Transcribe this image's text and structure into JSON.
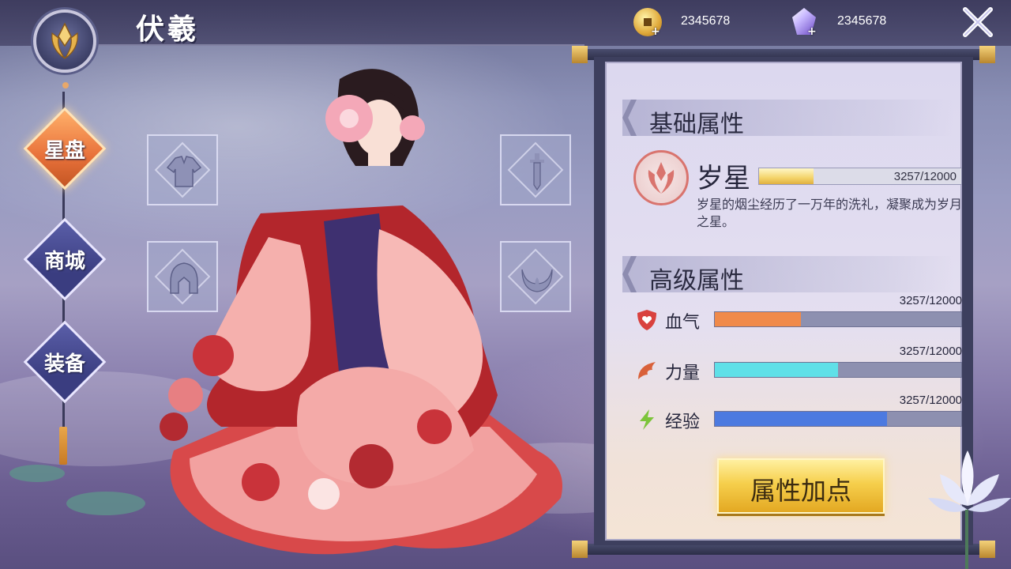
{
  "header": {
    "title": "伏羲",
    "currencies": [
      {
        "icon": "gold-coin-icon",
        "value": "2345678"
      },
      {
        "icon": "purple-crystal-icon",
        "value": "2345678"
      }
    ],
    "close_icon": "close-icon"
  },
  "nav": {
    "items": [
      {
        "label": "星盘",
        "active": true
      },
      {
        "label": "商城",
        "active": false
      },
      {
        "label": "装备",
        "active": false
      }
    ]
  },
  "equipment_slots": [
    {
      "icon": "robe-icon"
    },
    {
      "icon": "helmet-icon"
    },
    {
      "icon": "sword-icon"
    },
    {
      "icon": "amulet-icon"
    }
  ],
  "panel": {
    "basic_section": "基础属性",
    "star": {
      "name": "岁星",
      "progress": "3257/12000",
      "progress_fraction": 0.271,
      "description": "岁星的烟尘经历了一万年的洗礼，凝聚成为岁月之星。"
    },
    "advanced_section": "高级属性",
    "attributes": [
      {
        "name": "血气",
        "icon": "shield-heart-icon",
        "value": "3257/12000",
        "fill_percent": 35,
        "color": "#f08a4a"
      },
      {
        "name": "力量",
        "icon": "leaf-icon",
        "value": "3257/12000",
        "fill_percent": 50,
        "color": "#5fe0e8"
      },
      {
        "name": "经验",
        "icon": "lightning-icon",
        "value": "3257/12000",
        "fill_percent": 70,
        "color": "#4c7ae0"
      }
    ],
    "add_button": "属性加点"
  }
}
